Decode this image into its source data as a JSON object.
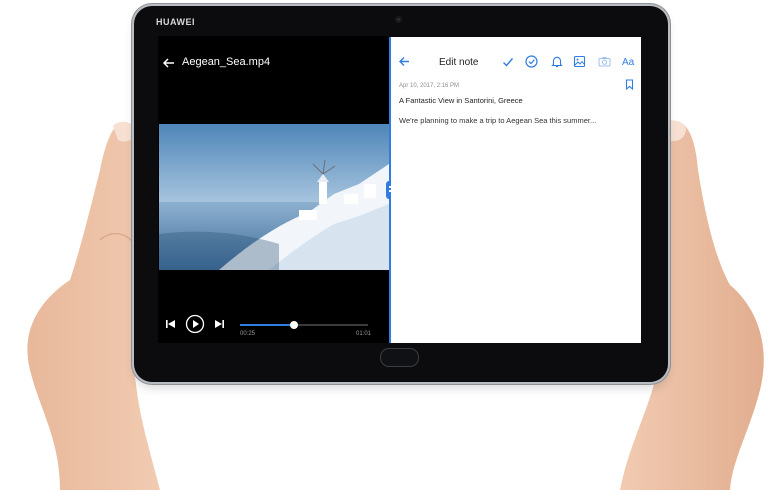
{
  "device": {
    "brand": "HUAWEI"
  },
  "video_player": {
    "title": "Aegean_Sea.mp4",
    "time_current": "00:25",
    "time_total": "01:01",
    "progress_fraction": 0.42,
    "icons": [
      "back-arrow-icon",
      "skip-previous-icon",
      "play-icon",
      "skip-next-icon"
    ]
  },
  "notes_app": {
    "title": "Edit note",
    "aa_label": "Aa",
    "icons": [
      "back-arrow-icon",
      "checkmark-icon",
      "checklist-icon",
      "bell-icon",
      "image-icon",
      "camera-icon",
      "bookmark-icon"
    ],
    "accent_color": "#2f7de1",
    "note": {
      "date": "Apr 10, 2017, 2:16 PM",
      "heading": "A Fantastic View in Santorini, Greece",
      "body": "We're planning to make a trip to Aegean Sea this summer..."
    }
  }
}
